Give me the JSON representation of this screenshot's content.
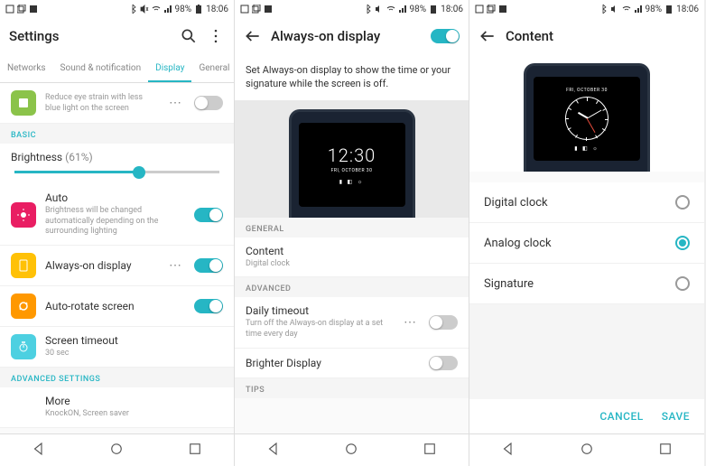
{
  "status": {
    "battery": "98%",
    "time": "18:06"
  },
  "s1": {
    "title": "Settings",
    "tabs": [
      "Networks",
      "Sound & notification",
      "Display",
      "General"
    ],
    "active_tab": "Display",
    "reader_sub": "Reduce eye strain with less blue light on the screen",
    "sections": {
      "basic": "BASIC",
      "advanced": "ADVANCED SETTINGS"
    },
    "brightness": {
      "label": "Brightness",
      "pct": "(61%)"
    },
    "auto": {
      "label": "Auto",
      "sub": "Brightness will be changed automatically depending on the surrounding lighting"
    },
    "aod": {
      "label": "Always-on display"
    },
    "rotate": {
      "label": "Auto-rotate screen"
    },
    "timeout": {
      "label": "Screen timeout",
      "sub": "30 sec"
    },
    "more": {
      "label": "More",
      "sub": "KnockON, Screen saver"
    }
  },
  "s2": {
    "title": "Always-on display",
    "desc": "Set Always-on display to show the time or your signature while the screen is off.",
    "preview": {
      "time": "12:30",
      "date": "FRI, OCTOBER 30"
    },
    "sections": {
      "general": "GENERAL",
      "advanced": "ADVANCED",
      "tips": "TIPS"
    },
    "content": {
      "label": "Content",
      "sub": "Digital clock"
    },
    "daily": {
      "label": "Daily timeout",
      "sub": "Turn off the Always-on display at a set time every day"
    },
    "brighter": {
      "label": "Brighter Display"
    }
  },
  "s3": {
    "title": "Content",
    "preview": {
      "date": "FRI, OCTOBER 30"
    },
    "options": {
      "digital": "Digital clock",
      "analog": "Analog clock",
      "signature": "Signature"
    },
    "selected": "analog",
    "actions": {
      "cancel": "CANCEL",
      "save": "SAVE"
    }
  }
}
